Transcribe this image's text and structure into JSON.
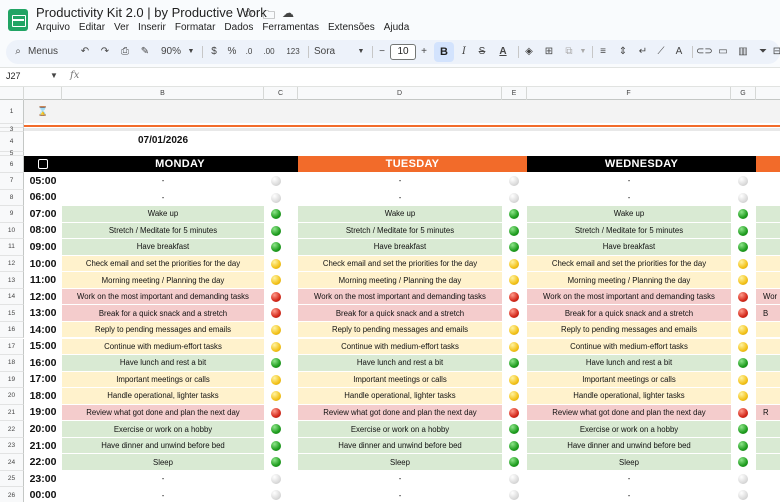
{
  "window": {
    "doc_title": "Productivity Kit 2.0 | by Productive Work",
    "menu": [
      "Arquivo",
      "Editar",
      "Ver",
      "Inserir",
      "Formatar",
      "Dados",
      "Ferramentas",
      "Extensões",
      "Ajuda"
    ]
  },
  "toolbar": {
    "menus_label": "Menus",
    "zoom": "90%",
    "currency": "$",
    "percent": "%",
    "decimals_less": ".0",
    "decimals_more": ".00",
    "number_format": "123",
    "font_name": "Sora",
    "font_size": "10",
    "bold": "B",
    "italic": "I",
    "strike": "S",
    "text_color": "A"
  },
  "formula_bar": {
    "cell_ref": "J27",
    "fx": "fx"
  },
  "columns": [
    "B",
    "C",
    "D",
    "E",
    "F",
    "G"
  ],
  "rows": {
    "numbers": [
      "1",
      "3",
      "4",
      "5",
      "6",
      "7",
      "8",
      "9",
      "10",
      "11",
      "12",
      "13",
      "14",
      "15",
      "16",
      "17",
      "18",
      "19",
      "20",
      "21",
      "22",
      "23",
      "24",
      "25",
      "26"
    ],
    "times": [
      "05:00",
      "06:00",
      "07:00",
      "08:00",
      "09:00",
      "10:00",
      "11:00",
      "12:00",
      "13:00",
      "14:00",
      "15:00",
      "16:00",
      "17:00",
      "18:00",
      "19:00",
      "20:00",
      "21:00",
      "22:00",
      "23:00",
      "00:00"
    ]
  },
  "schedule": {
    "date": "07/01/2026",
    "days": [
      "MONDAY",
      "TUESDAY",
      "WEDNESDAY"
    ],
    "tasks": [
      "-",
      "-",
      "Wake up",
      "Stretch / Meditate for 5 minutes",
      "Have breakfast",
      "Check email and set the priorities for the day",
      "Morning meeting / Planning the day",
      "Work on the most important and demanding tasks",
      "Break for a quick snack and a stretch",
      "Reply to pending messages and emails",
      "Continue with medium-effort tasks",
      "Have lunch and rest a bit",
      "Important meetings or calls",
      "Handle operational, lighter tasks",
      "Review what got done and plan the next day",
      "Exercise or work on a hobby",
      "Have dinner and unwind before bed",
      "Sleep",
      "-",
      "-"
    ],
    "status": [
      "gray",
      "gray",
      "green",
      "green",
      "green",
      "yellow",
      "yellow",
      "red",
      "red",
      "yellow",
      "yellow",
      "green",
      "yellow",
      "yellow",
      "red",
      "green",
      "green",
      "green",
      "gray",
      "gray"
    ],
    "partial_next_day": [
      "Wor",
      "B",
      "R"
    ]
  },
  "colors": {
    "green": "#d9ead3",
    "yellow": "#fff2cc",
    "red": "#f4cccc",
    "day_dark": "#000000",
    "day_orange": "#f26b2a",
    "brand": "#21a464"
  }
}
